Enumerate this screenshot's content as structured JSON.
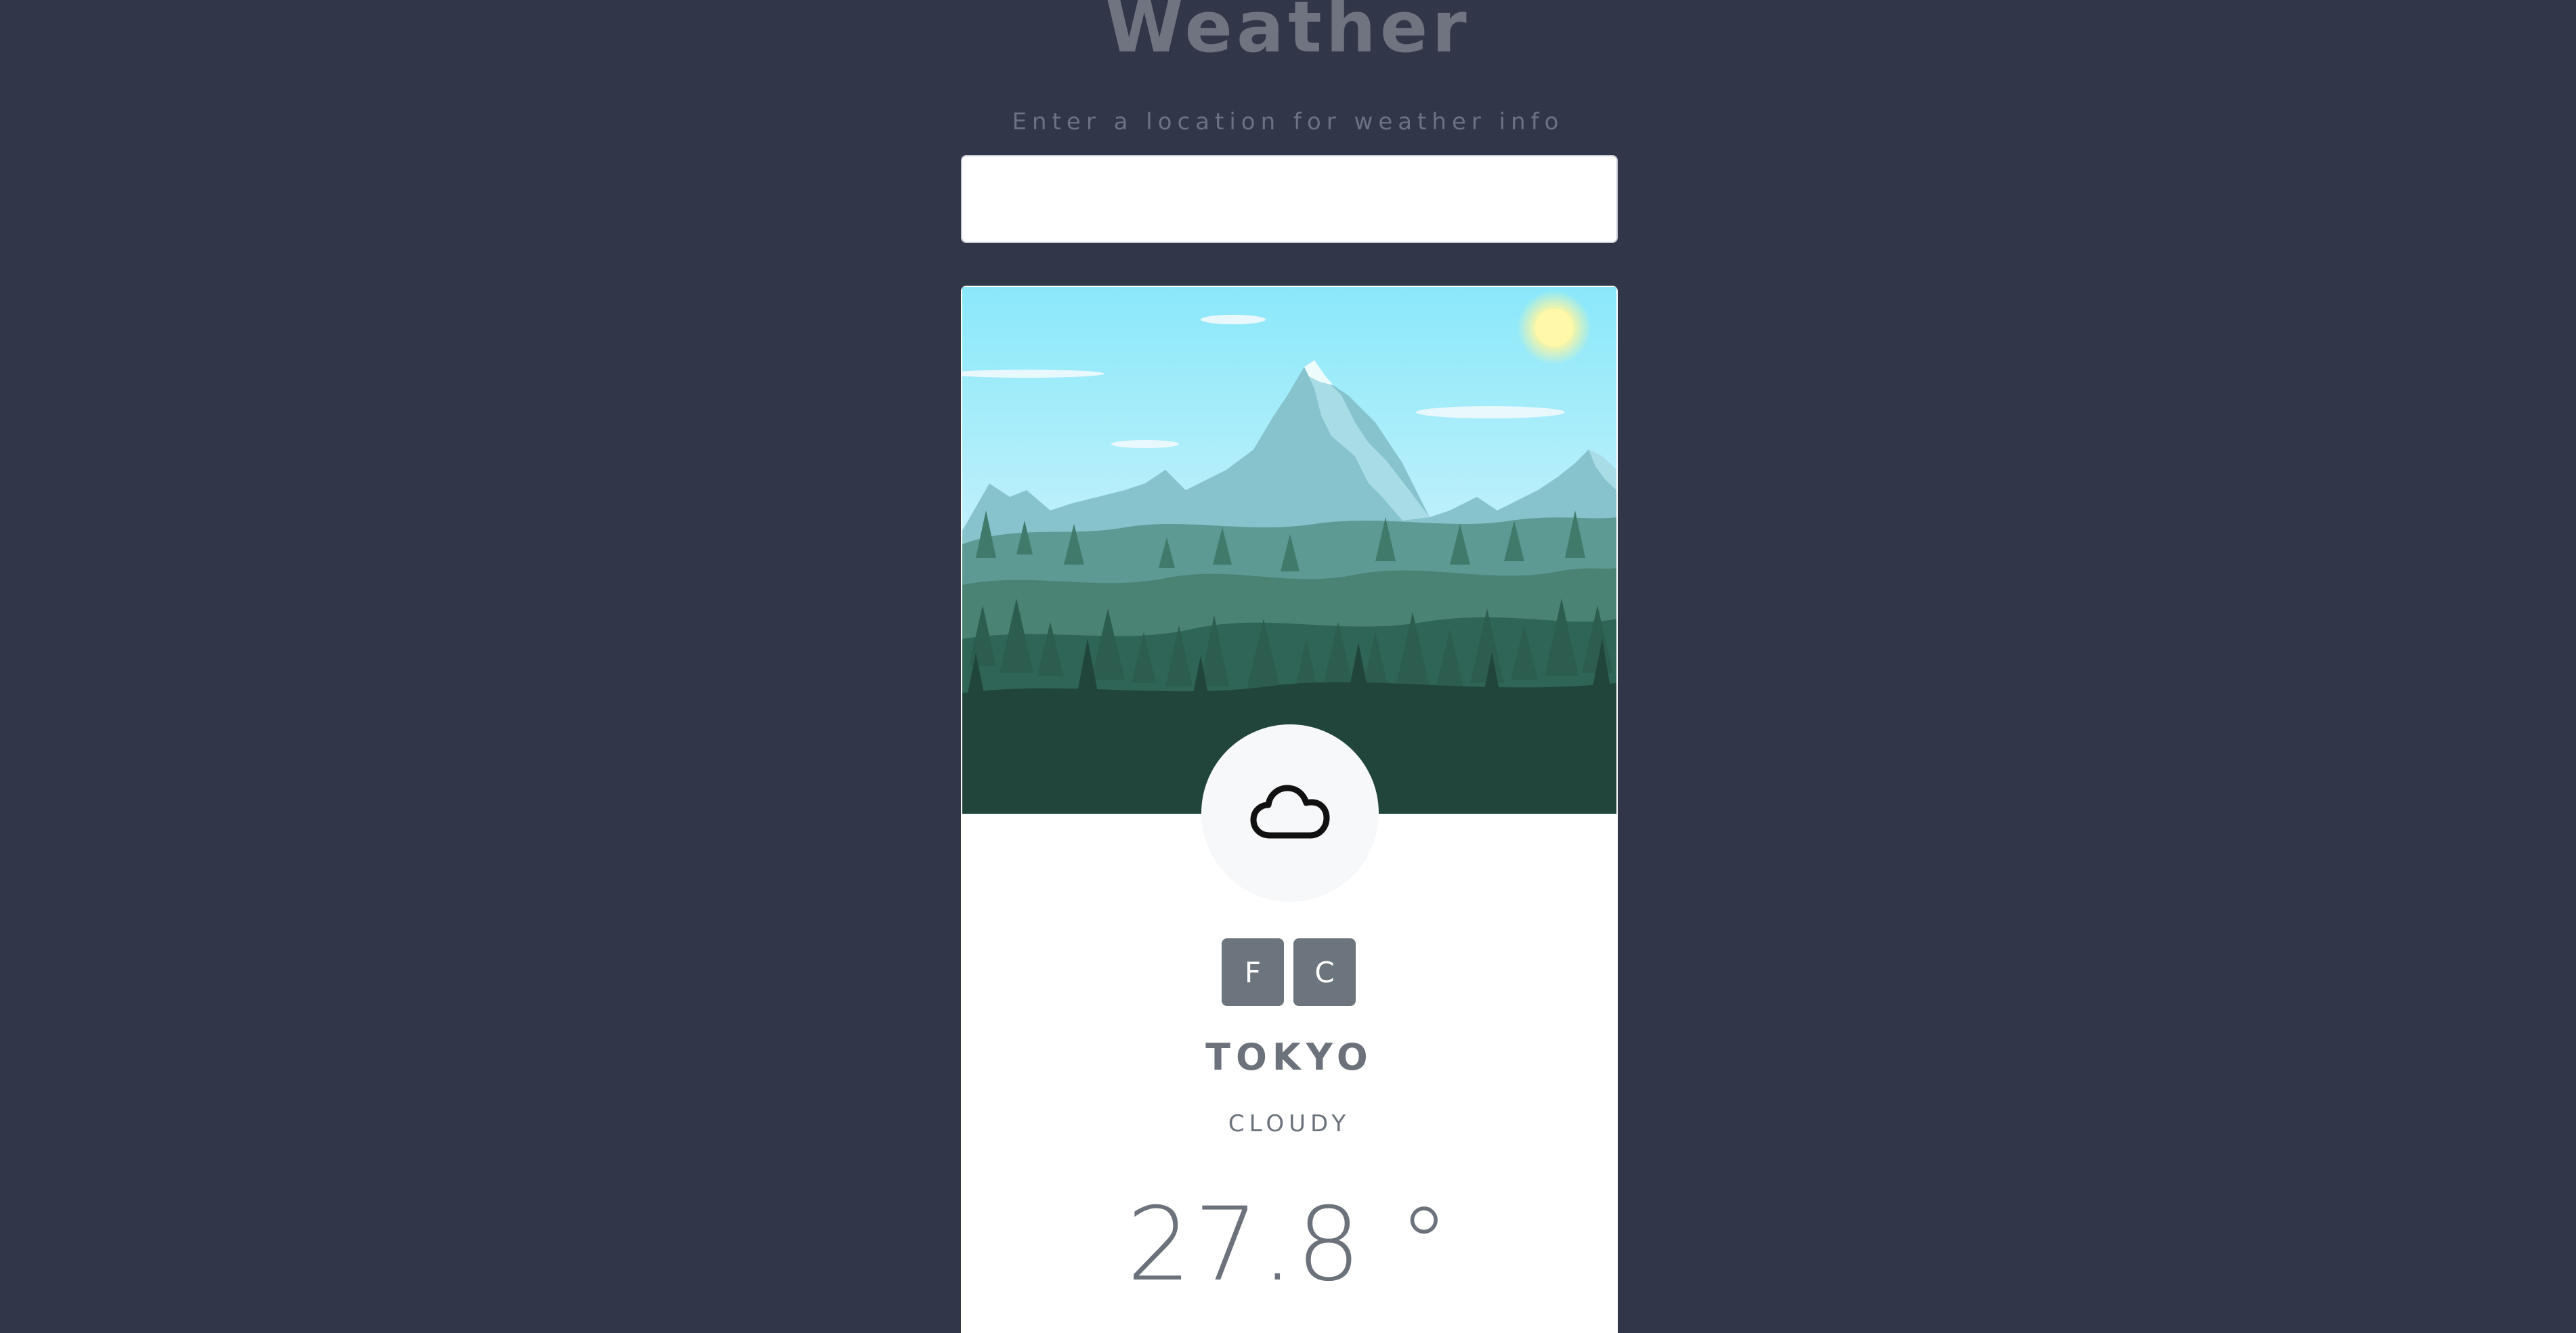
{
  "app": {
    "title": "Weather",
    "prompt": "Enter a location for weather info"
  },
  "search": {
    "value": "",
    "placeholder": ""
  },
  "card": {
    "condition_icon": "cloud-icon",
    "units": {
      "fahrenheit_label": "F",
      "celsius_label": "C"
    },
    "city": "TOKYO",
    "condition": "CLOUDY",
    "temperature": "27.8 °"
  },
  "colors": {
    "background": "#313649",
    "card": "#ffffff",
    "button": "#6c757d",
    "text_muted": "#6c727c"
  }
}
